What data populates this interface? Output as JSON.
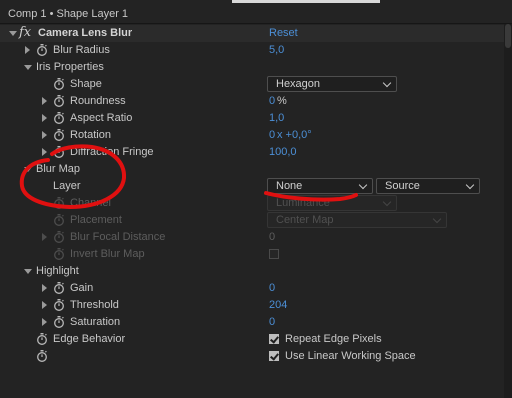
{
  "header": {
    "title": "Comp 1 • Shape Layer 1"
  },
  "effect": {
    "fx": "fx",
    "name": "Camera Lens Blur",
    "reset": "Reset"
  },
  "rows": {
    "blur_radius": {
      "label": "Blur Radius",
      "value": "5,0"
    },
    "iris_properties": {
      "label": "Iris Properties"
    },
    "shape": {
      "label": "Shape",
      "value": "Hexagon"
    },
    "roundness": {
      "label": "Roundness",
      "value": "0",
      "unit": "%"
    },
    "aspect_ratio": {
      "label": "Aspect Ratio",
      "value": "1,0"
    },
    "rotation": {
      "label": "Rotation",
      "value": "0",
      "unit": "x +0,0°"
    },
    "diffraction_fringe": {
      "label": "Diffraction Fringe",
      "value": "100,0"
    },
    "blur_map": {
      "label": "Blur Map"
    },
    "layer": {
      "label": "Layer",
      "value": "None",
      "source": "Source"
    },
    "channel": {
      "label": "Channel",
      "value": "Luminance"
    },
    "placement": {
      "label": "Placement",
      "value": "Center Map"
    },
    "blur_focal_distance": {
      "label": "Blur Focal Distance",
      "value": "0"
    },
    "invert_blur_map": {
      "label": "Invert Blur Map"
    },
    "highlight": {
      "label": "Highlight"
    },
    "gain": {
      "label": "Gain",
      "value": "0"
    },
    "threshold": {
      "label": "Threshold",
      "value": "204"
    },
    "saturation": {
      "label": "Saturation",
      "value": "0"
    },
    "edge_behavior": {
      "label": "Edge Behavior",
      "checkbox": "Repeat Edge Pixels"
    },
    "linear": {
      "checkbox": "Use Linear Working Space"
    }
  },
  "colors": {
    "accent": "#4c8fd6",
    "annotation": "#e01010",
    "panel": "#232323"
  },
  "icons": [
    "stopwatch-icon",
    "twirl-arrow-icon",
    "dropdown-chevron-icon",
    "checkbox-icon"
  ]
}
